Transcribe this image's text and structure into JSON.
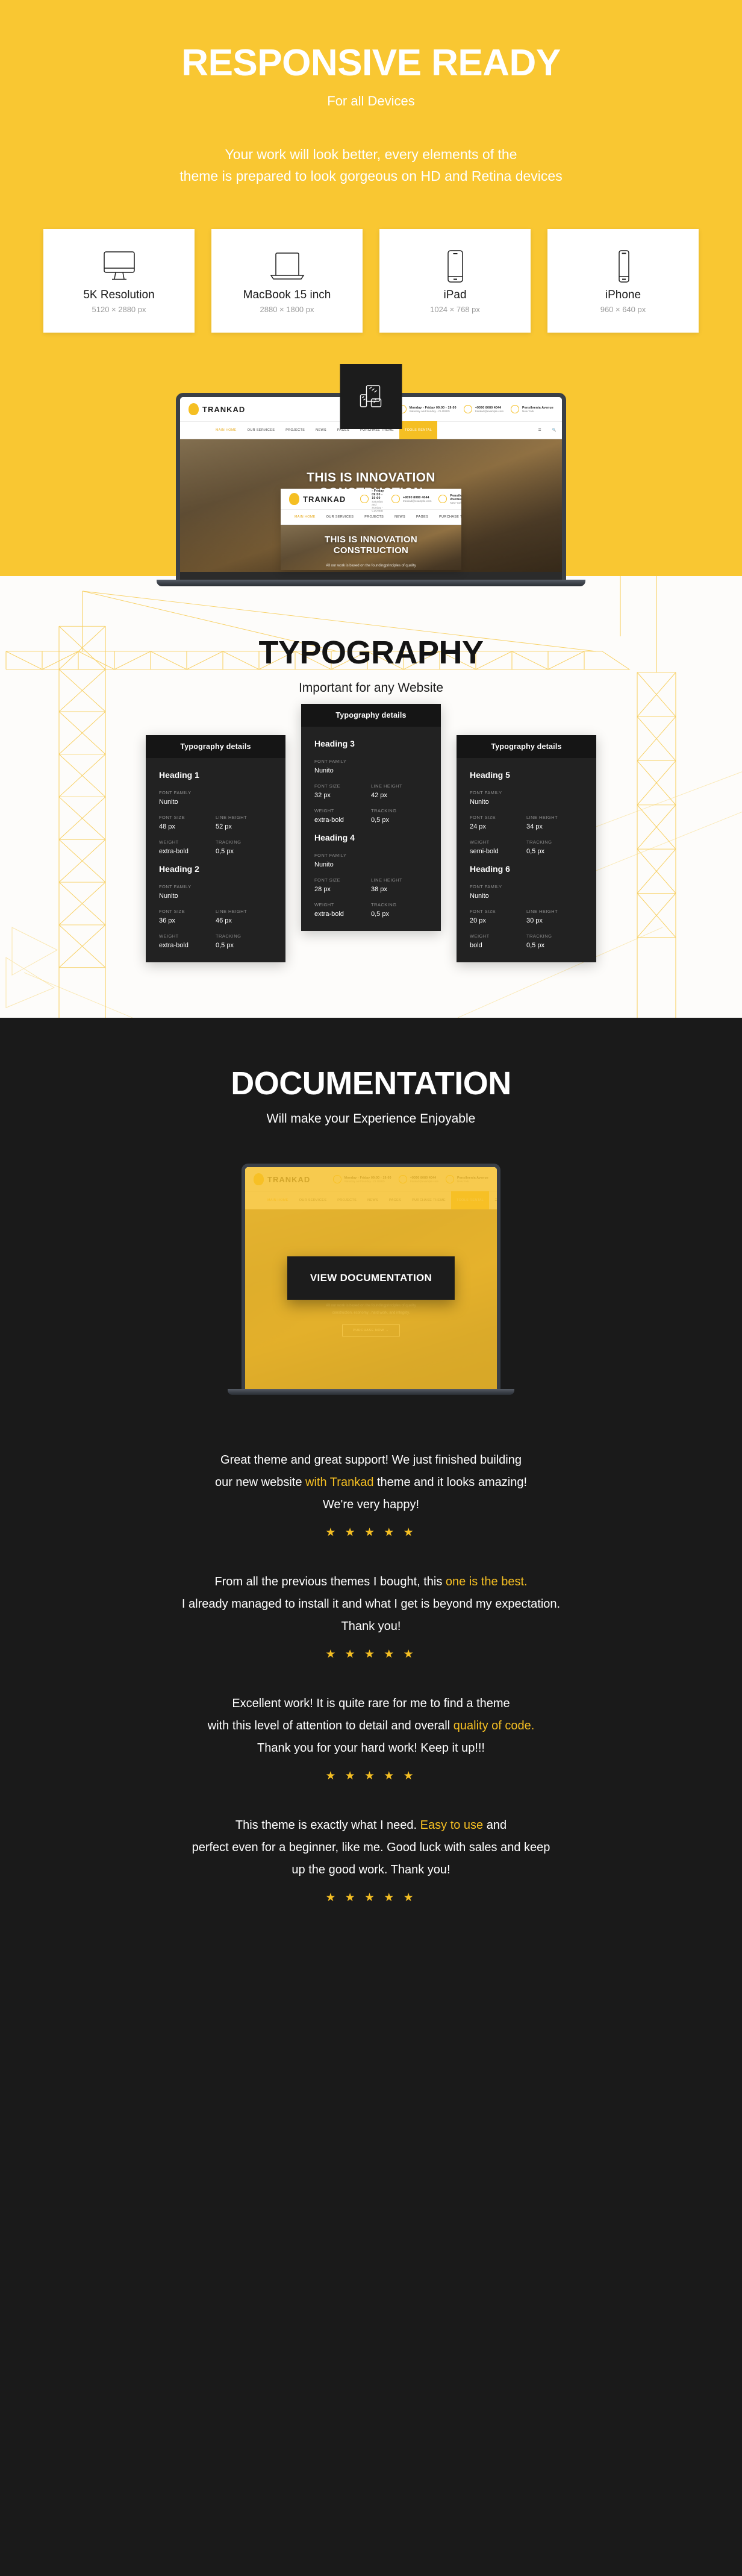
{
  "responsive": {
    "title": "RESPONSIVE READY",
    "subtitle": "For all Devices",
    "lead_line1": "Your work will look better, every elements of the",
    "lead_line2": "theme is prepared to look gorgeous on HD and Retina devices",
    "devices": [
      {
        "icon": "desktop-monitor-icon",
        "name": "5K Resolution",
        "resolution": "5120 × 2880 px"
      },
      {
        "icon": "laptop-icon",
        "name": "MacBook 15 inch",
        "resolution": "2880 × 1800 px"
      },
      {
        "icon": "tablet-icon",
        "name": "iPad",
        "resolution": "1024 × 768 px"
      },
      {
        "icon": "smartphone-icon",
        "name": "iPhone",
        "resolution": "960 × 640 px"
      }
    ]
  },
  "site_preview": {
    "logo": "TRANKAD",
    "hours_title": "Monday - Friday 09:00 - 19:00",
    "hours_sub": "Saturday and Sunday - CLOSED",
    "phone": "+9090 8080 4044",
    "email": "trankad@example.com",
    "address_title": "Pensilvenia Avenue",
    "address_sub": "New York",
    "nav": [
      "MAIN HOME",
      "OUR SERVICES",
      "PROJECTS",
      "NEWS",
      "PAGES",
      "PURCHASE THEME",
      "TOOLS RENTAL"
    ],
    "hero_line1": "THIS IS INNOVATION",
    "hero_line2": "CONSTRUCTION",
    "hero_p1": "All our work is based on the foundingprinciples of quality",
    "hero_p2": "construction, economy , hard work, and integrity.",
    "hero_button": "PURCHASE NOW"
  },
  "typography": {
    "title": "TYPOGRAPHY",
    "subtitle": "Important for any Website",
    "card_head": "Typography details",
    "labels": {
      "font_family": "FONT FAMILY",
      "font_size": "FONT SIZE",
      "line_height": "LINE HEIGHT",
      "weight": "WEIGHT",
      "tracking": "TRACKING"
    },
    "cards": [
      {
        "entries": [
          {
            "heading": "Heading 1",
            "font_family": "Nunito",
            "font_size": "48 px",
            "line_height": "52 px",
            "weight": "extra-bold",
            "tracking": "0,5 px"
          },
          {
            "heading": "Heading 2",
            "font_family": "Nunito",
            "font_size": "36 px",
            "line_height": "46 px",
            "weight": "extra-bold",
            "tracking": "0,5 px"
          }
        ]
      },
      {
        "entries": [
          {
            "heading": "Heading 3",
            "font_family": "Nunito",
            "font_size": "32 px",
            "line_height": "42 px",
            "weight": "extra-bold",
            "tracking": "0,5 px"
          },
          {
            "heading": "Heading 4",
            "font_family": "Nunito",
            "font_size": "28 px",
            "line_height": "38 px",
            "weight": "extra-bold",
            "tracking": "0,5 px"
          }
        ]
      },
      {
        "entries": [
          {
            "heading": "Heading 5",
            "font_family": "Nunito",
            "font_size": "24 px",
            "line_height": "34 px",
            "weight": "semi-bold",
            "tracking": "0,5 px"
          },
          {
            "heading": "Heading 6",
            "font_family": "Nunito",
            "font_size": "20 px",
            "line_height": "30 px",
            "weight": "bold",
            "tracking": "0,5 px"
          }
        ]
      }
    ]
  },
  "documentation": {
    "title": "DOCUMENTATION",
    "subtitle": "Will make your Experience Enjoyable",
    "button": "VIEW DOCUMENTATION"
  },
  "testimonials": [
    {
      "lines": [
        [
          {
            "t": "Great theme and great support! We just finished building",
            "hl": false
          }
        ],
        [
          {
            "t": "our new website ",
            "hl": false
          },
          {
            "t": "with Trankad",
            "hl": true
          },
          {
            "t": " theme and it looks amazing!",
            "hl": false
          }
        ],
        [
          {
            "t": "We're very happy!",
            "hl": false
          }
        ]
      ],
      "stars": "★ ★ ★ ★ ★"
    },
    {
      "lines": [
        [
          {
            "t": "From all the previous themes I bought, this ",
            "hl": false
          },
          {
            "t": "one is the best.",
            "hl": true
          }
        ],
        [
          {
            "t": "I already managed to install it and what I get is beyond my expectation.",
            "hl": false
          }
        ],
        [
          {
            "t": "Thank you!",
            "hl": false
          }
        ]
      ],
      "stars": "★ ★ ★ ★ ★"
    },
    {
      "lines": [
        [
          {
            "t": "Excellent work! It is quite rare for me to find a theme",
            "hl": false
          }
        ],
        [
          {
            "t": "with this level of attention to detail and overall ",
            "hl": false
          },
          {
            "t": "quality of code.",
            "hl": true
          }
        ],
        [
          {
            "t": "Thank you for your hard work! Keep it up!!!",
            "hl": false
          }
        ]
      ],
      "stars": "★ ★ ★ ★ ★"
    },
    {
      "lines": [
        [
          {
            "t": "This theme is exactly what I need. ",
            "hl": false
          },
          {
            "t": "Easy to use",
            "hl": true
          },
          {
            "t": " and",
            "hl": false
          }
        ],
        [
          {
            "t": "perfect even for a beginner, like me. Good luck with sales and keep",
            "hl": false
          }
        ],
        [
          {
            "t": "up the good work. Thank you!",
            "hl": false
          }
        ]
      ],
      "stars": "★ ★ ★ ★ ★"
    }
  ],
  "colors": {
    "brand_yellow": "#f9c732",
    "accent_yellow": "#f5bf23",
    "dark": "#1a1a1a",
    "card_dark": "#222222",
    "card_head_dark": "#151515"
  }
}
